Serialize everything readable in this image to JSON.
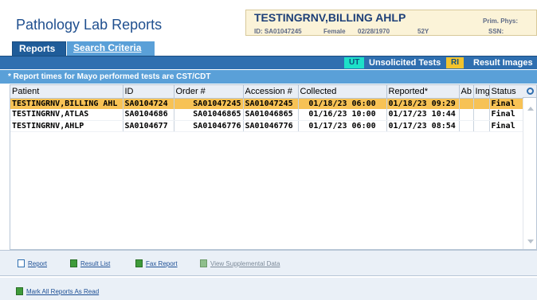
{
  "app": {
    "title": "Pathology Lab Reports"
  },
  "patient": {
    "name": "TESTINGRNV,BILLING AHLP",
    "id_line": "ID: SA01047245",
    "sex": "Female",
    "dob": "02/28/1970",
    "age": "52Y",
    "prim_phys_label": "Prim. Phys:",
    "ssn_label": "SSN:"
  },
  "tabs": [
    {
      "label": "Reports",
      "active": true
    },
    {
      "label": "Search Criteria",
      "active": false
    }
  ],
  "toolbar": {
    "ut_badge": "UT",
    "ut_label": "Unsolicited Tests",
    "ri_badge": "RI",
    "ri_label": "Result Images"
  },
  "notice": "* Report times for Mayo performed tests are CST/CDT",
  "table": {
    "headers": [
      "Patient",
      "ID",
      "Order #",
      "Accession #",
      "Collected",
      "Reported*",
      "Ab",
      "Img",
      "Status"
    ],
    "rows": [
      {
        "patient": "TESTINGRNV,BILLING AHL",
        "id": "SA0104724",
        "order": "SA01047245",
        "accession": "SA01047245",
        "collected": "01/18/23 06:00",
        "reported": "01/18/23 09:29",
        "ab": "",
        "img": "",
        "status": "Final",
        "selected": true
      },
      {
        "patient": "TESTINGRNV,ATLAS",
        "id": "SA0104686",
        "order": "SA01046865",
        "accession": "SA01046865",
        "collected": "01/16/23 10:00",
        "reported": "01/17/23 10:44",
        "ab": "",
        "img": "",
        "status": "Final",
        "selected": false
      },
      {
        "patient": "TESTINGRNV,AHLP",
        "id": "SA0104677",
        "order": "SA01046776",
        "accession": "SA01046776",
        "collected": "01/17/23 06:00",
        "reported": "01/17/23 08:54",
        "ab": "",
        "img": "",
        "status": "Final",
        "selected": false
      }
    ]
  },
  "actions": {
    "report": "Report",
    "result_list": "Result List",
    "fax_report": "Fax Report",
    "view_supplemental": "View Supplemental Data"
  },
  "footer": {
    "mark_all_read": "Mark All Reports As Read"
  },
  "colors": {
    "accent_blue": "#2f6fb0",
    "selected_row": "#f7c255",
    "ut_badge": "#1de0c8",
    "ri_badge": "#f2c32d"
  }
}
